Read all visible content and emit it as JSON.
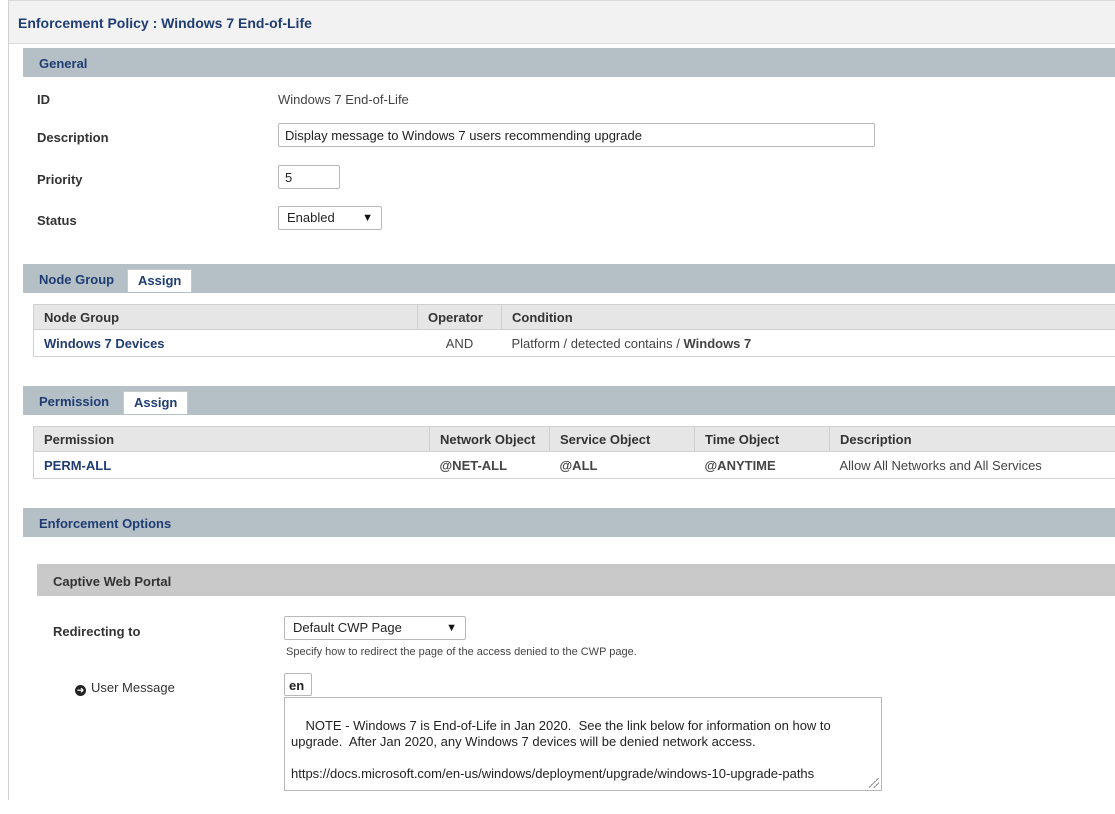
{
  "page": {
    "title": "Enforcement Policy : Windows 7 End-of-Life"
  },
  "general": {
    "section_label": "General",
    "id_label": "ID",
    "id_value": "Windows 7 End-of-Life",
    "description_label": "Description",
    "description_value": "Display message to Windows 7 users recommending upgrade",
    "priority_label": "Priority",
    "priority_value": "5",
    "status_label": "Status",
    "status_value": "Enabled"
  },
  "node_group": {
    "section_label": "Node Group",
    "assign_label": "Assign",
    "columns": [
      "Node Group",
      "Operator",
      "Condition"
    ],
    "row": {
      "name": "Windows 7 Devices",
      "operator": "AND",
      "condition_prefix": "Platform / detected contains / ",
      "condition_value": "Windows 7"
    }
  },
  "permission": {
    "section_label": "Permission",
    "assign_label": "Assign",
    "columns": [
      "Permission",
      "Network Object",
      "Service Object",
      "Time Object",
      "Description"
    ],
    "row": {
      "name": "PERM-ALL",
      "network": "@NET-ALL",
      "service": "@ALL",
      "time": "@ANYTIME",
      "description": "Allow All Networks and All Services"
    }
  },
  "enforcement": {
    "section_label": "Enforcement Options",
    "cwp_label": "Captive Web Portal",
    "redirect_label": "Redirecting to",
    "redirect_value": "Default CWP Page",
    "redirect_hint": "Specify how to redirect the page of the access denied to the CWP page.",
    "user_message_label": "User Message",
    "language_value": "en",
    "message_text": "NOTE - Windows 7 is End-of-Life in Jan 2020.  See the link below for information on how to upgrade.  After Jan 2020, any Windows 7 devices will be denied network access.\n\nhttps://docs.microsoft.com/en-us/windows/deployment/upgrade/windows-10-upgrade-paths"
  },
  "icons": {
    "select_arrow": "triangle-down-icon",
    "user_message": "circle-arrow-right-icon",
    "resize": "resize-grip-icon"
  }
}
